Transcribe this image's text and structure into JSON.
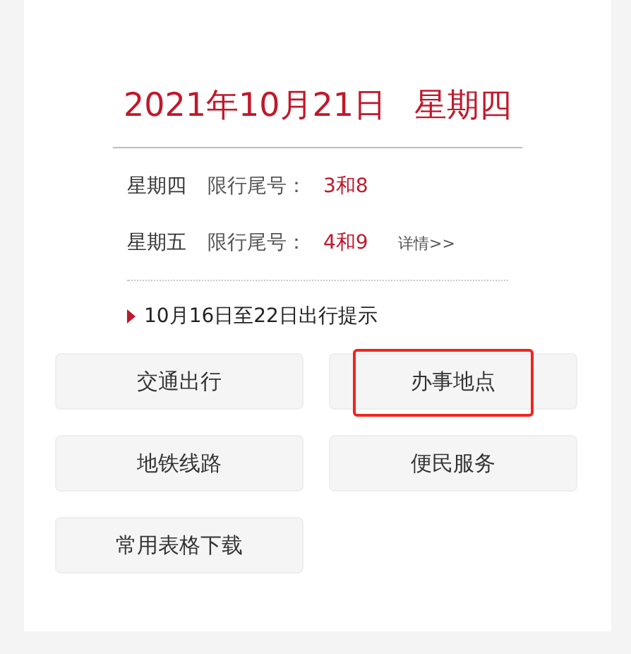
{
  "date_title": {
    "date": "2021年10月21日",
    "weekday": "星期四"
  },
  "restrictions": [
    {
      "day": "星期四",
      "label": "限行尾号：",
      "numbers": "3和8"
    },
    {
      "day": "星期五",
      "label": "限行尾号：",
      "numbers": "4和9",
      "link": "详情>>"
    }
  ],
  "notice": "10月16日至22日出行提示",
  "buttons": [
    {
      "label": "交通出行",
      "highlighted": false
    },
    {
      "label": "办事地点",
      "highlighted": true
    },
    {
      "label": "地铁线路",
      "highlighted": false
    },
    {
      "label": "便民服务",
      "highlighted": false
    },
    {
      "label": "常用表格下载",
      "highlighted": false
    }
  ]
}
